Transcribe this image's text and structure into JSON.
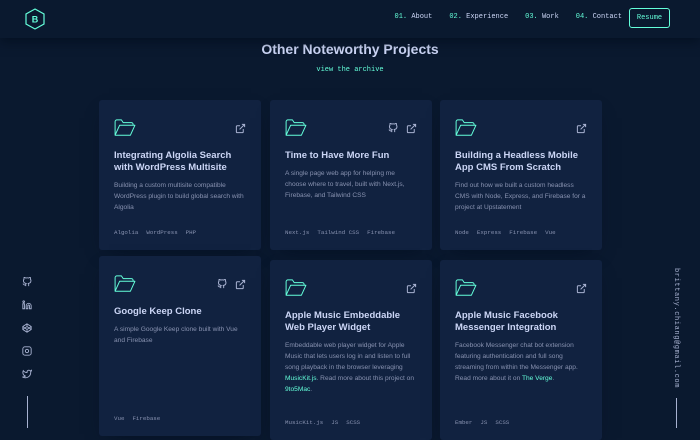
{
  "nav": {
    "logo": "B",
    "links": [
      {
        "num": "01.",
        "label": "About"
      },
      {
        "num": "02.",
        "label": "Experience"
      },
      {
        "num": "03.",
        "label": "Work"
      },
      {
        "num": "04.",
        "label": "Contact"
      }
    ],
    "resume": "Resume"
  },
  "section": {
    "title": "Other Noteworthy Projects",
    "archive_link": "view the archive"
  },
  "projects": [
    {
      "title": "Integrating Algolia Search with WordPress Multisite",
      "desc": "Building a custom multisite compatible WordPress plugin to build global search with Algolia",
      "tags": [
        "Algolia",
        "WordPress",
        "PHP"
      ]
    },
    {
      "title": "Time to Have More Fun",
      "desc": "A single page web app for helping me choose where to travel, built with Next.js, Firebase, and Tailwind CSS",
      "tags": [
        "Next.js",
        "Tailwind CSS",
        "Firebase"
      ]
    },
    {
      "title": "Building a Headless Mobile App CMS From Scratch",
      "desc": "Find out how we built a custom headless CMS with Node, Express, and Firebase for a project at Upstatement",
      "tags": [
        "Node",
        "Express",
        "Firebase",
        "Vue"
      ]
    },
    {
      "title": "Google Keep Clone",
      "desc": "A simple Google Keep clone built with Vue and Firebase",
      "tags": [
        "Vue",
        "Firebase"
      ]
    },
    {
      "title": "Apple Music Embeddable Web Player Widget",
      "desc_parts": [
        "Embeddable web player widget for Apple Music that lets users log in and listen to full song playback in the browser leveraging ",
        "MusicKit.js",
        ". Read more about this project on ",
        "9to5Mac",
        "."
      ],
      "tags": [
        "MusicKit.js",
        "JS",
        "SCSS"
      ]
    },
    {
      "title": "Apple Music Facebook Messenger Integration",
      "desc_parts": [
        "Facebook Messenger chat bot extension featuring authentication and full song streaming from within the Messenger app. Read more about it on ",
        "The Verge",
        "."
      ],
      "tags": [
        "Ember",
        "JS",
        "SCSS"
      ]
    }
  ],
  "email": "brittany.chiang@gmail.com",
  "colors": {
    "bg": "#0a192f",
    "card": "#112240",
    "accent": "#64ffda",
    "heading": "#ccd6f6"
  }
}
